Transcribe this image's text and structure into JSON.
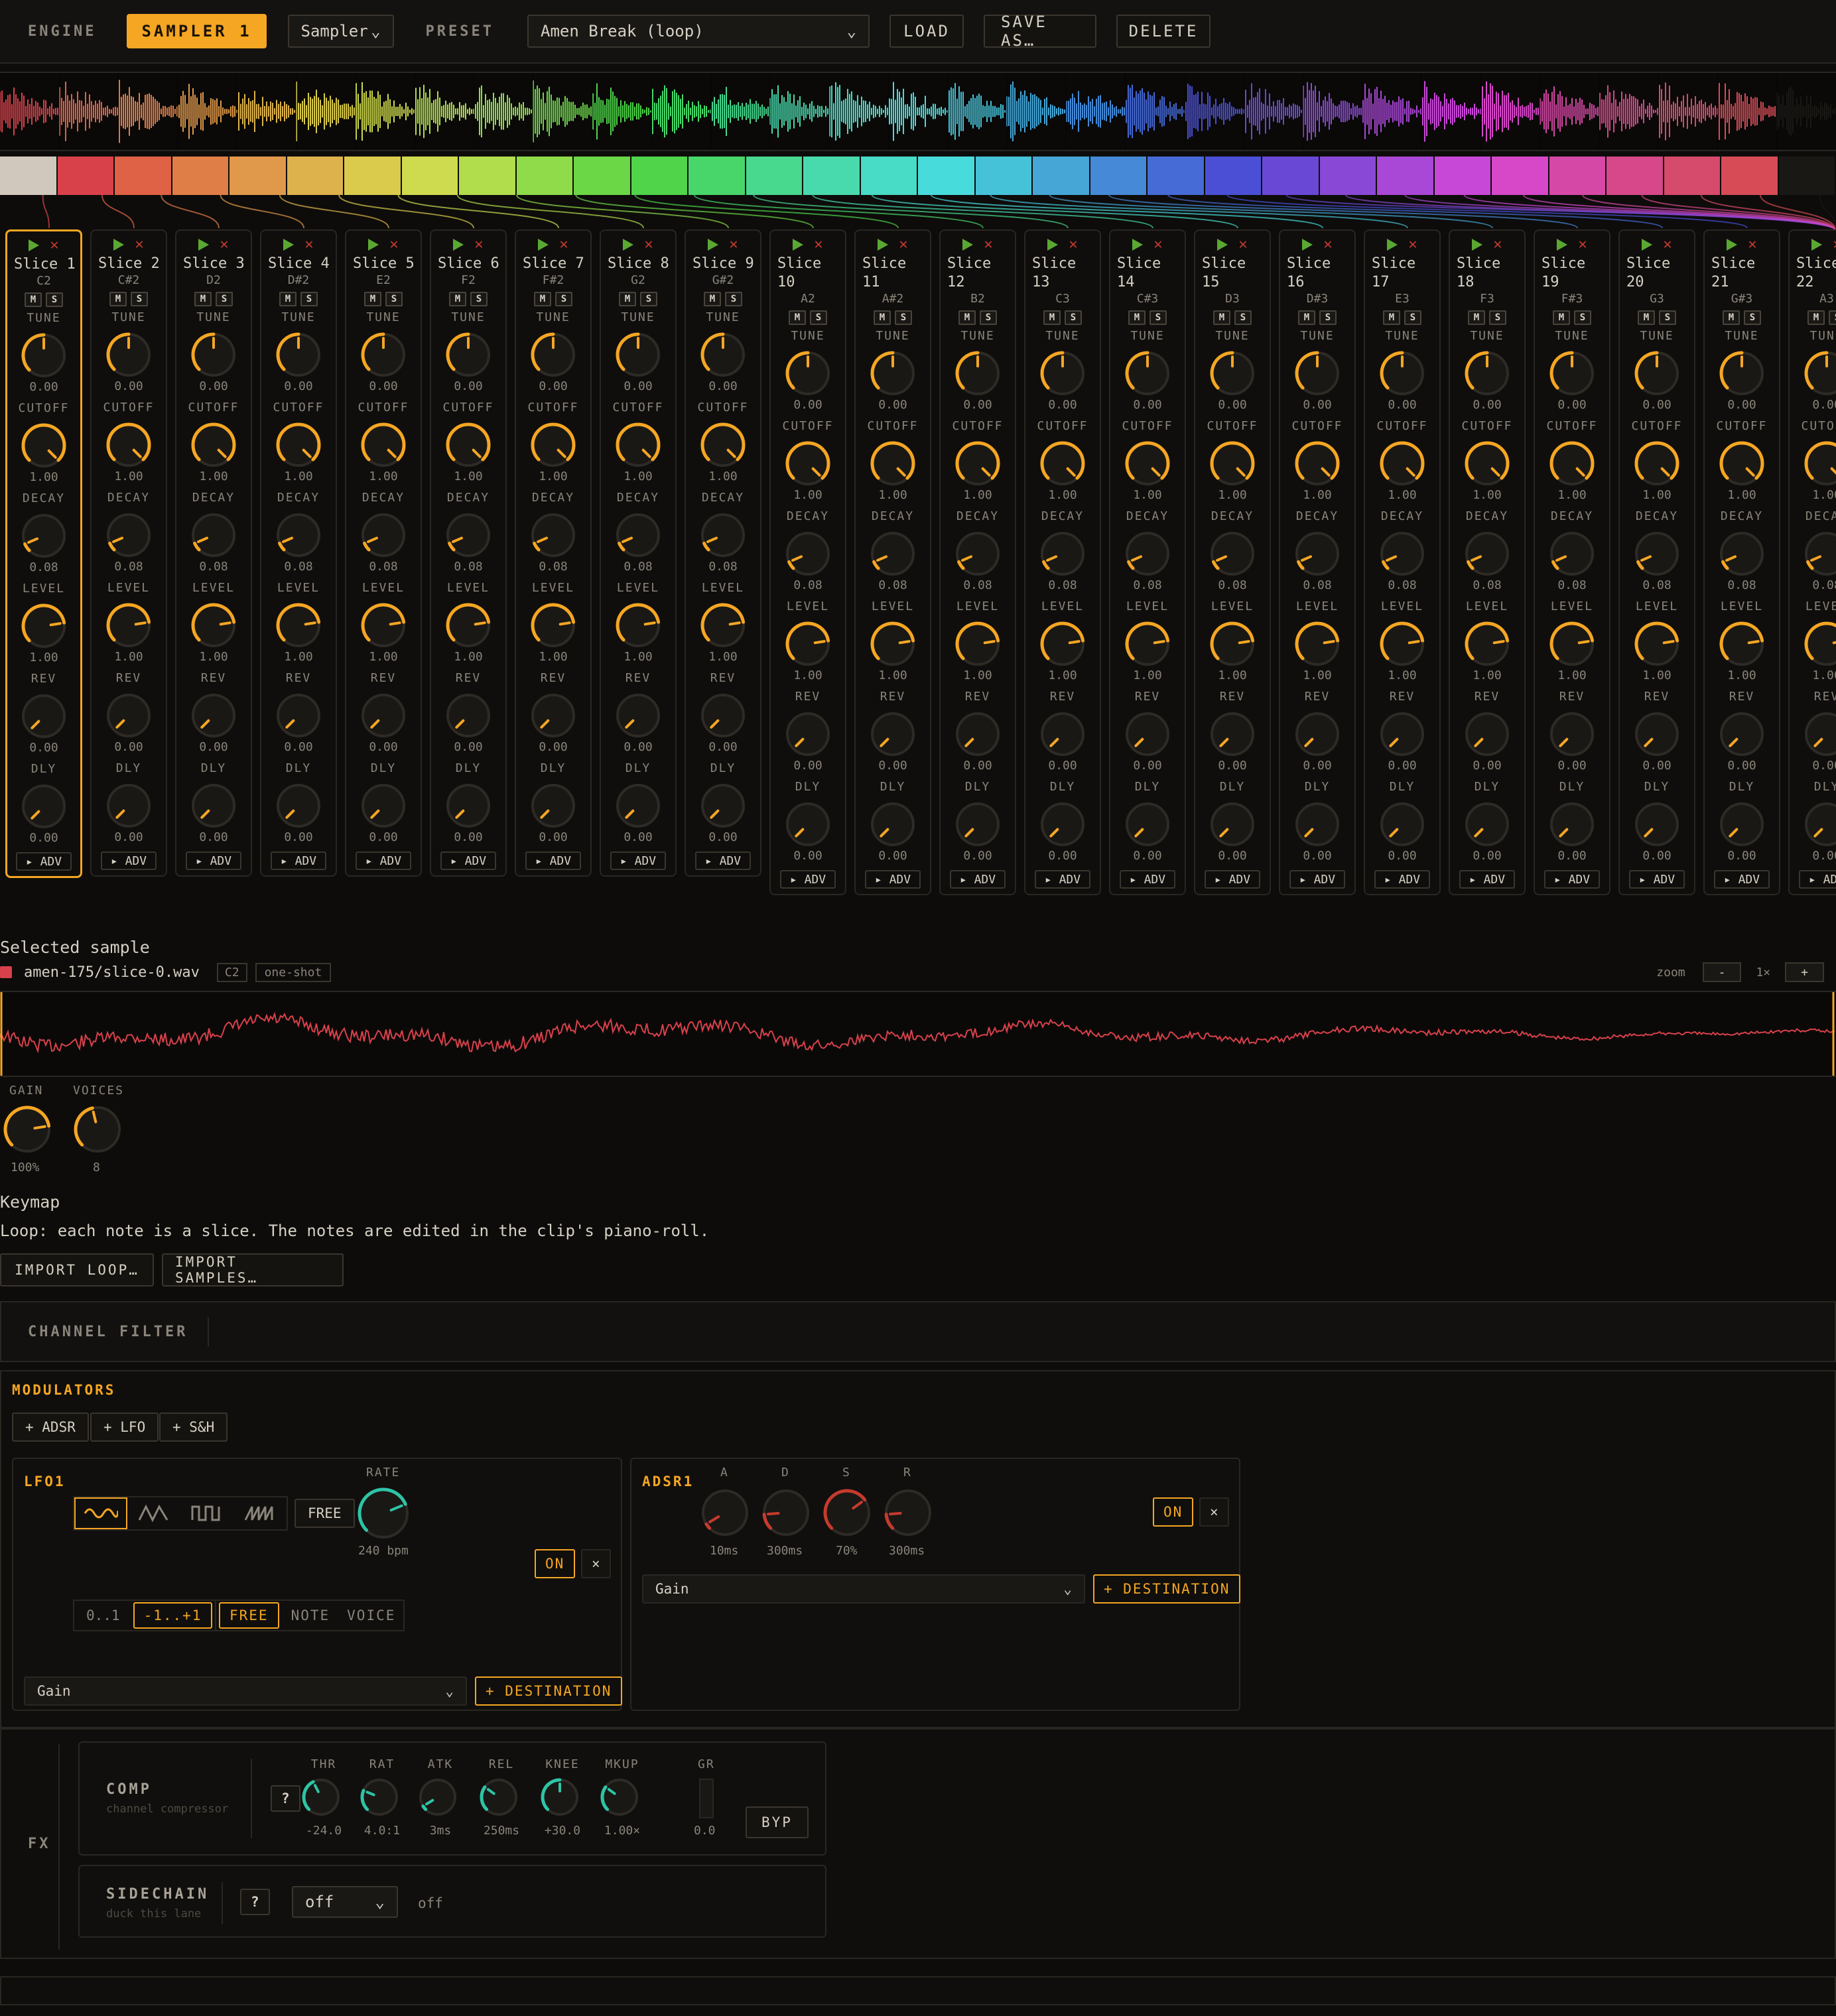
{
  "header": {
    "engine_label": "ENGINE",
    "engine_value": "SAMPLER 1",
    "engine_type": "Sampler",
    "preset_label": "PRESET",
    "preset_value": "Amen Break (loop)",
    "load": "LOAD",
    "save_as": "SAVE AS…",
    "delete": "DELETE"
  },
  "colors": {
    "accent": "#f5a623",
    "teal": "#2ec4a6",
    "red": "#c63a2e",
    "slice_colors": [
      "#d0c8bc",
      "#d9414a",
      "#df6146",
      "#e07e48",
      "#e0994a",
      "#ddb24c",
      "#dacb4c",
      "#cfdb4e",
      "#b1dc4c",
      "#8fdb4a",
      "#6cd746",
      "#4fd44a",
      "#48d66a",
      "#48d88e",
      "#48daad",
      "#48dbc6",
      "#48dbdb",
      "#46c2d8",
      "#46a6d6",
      "#4689d6",
      "#466ad6",
      "#4a4fd6",
      "#6a48d6",
      "#8a48d6",
      "#a948d6",
      "#c748d6",
      "#d648c8",
      "#d648a6",
      "#d6488a",
      "#d64a6c",
      "#d64b56",
      "#1a1815"
    ]
  },
  "slices": [
    {
      "name": "Slice 1",
      "note": "C2"
    },
    {
      "name": "Slice 2",
      "note": "C#2"
    },
    {
      "name": "Slice 3",
      "note": "D2"
    },
    {
      "name": "Slice 4",
      "note": "D#2"
    },
    {
      "name": "Slice 5",
      "note": "E2"
    },
    {
      "name": "Slice 6",
      "note": "F2"
    },
    {
      "name": "Slice 7",
      "note": "F#2"
    },
    {
      "name": "Slice 8",
      "note": "G2"
    },
    {
      "name": "Slice 9",
      "note": "G#2"
    },
    {
      "name": "Slice\n10",
      "note": "A2"
    },
    {
      "name": "Slice\n11",
      "note": "A#2"
    },
    {
      "name": "Slice\n12",
      "note": "B2"
    },
    {
      "name": "Slice\n13",
      "note": "C3"
    },
    {
      "name": "Slice\n14",
      "note": "C#3"
    },
    {
      "name": "Slice\n15",
      "note": "D3"
    },
    {
      "name": "Slice\n16",
      "note": "D#3"
    },
    {
      "name": "Slice\n17",
      "note": "E3"
    },
    {
      "name": "Slice\n18",
      "note": "F3"
    },
    {
      "name": "Slice\n19",
      "note": "F#3"
    },
    {
      "name": "Slice\n20",
      "note": "G3"
    },
    {
      "name": "Slice\n21",
      "note": "G#3"
    },
    {
      "name": "Slice\n22",
      "note": "A3"
    }
  ],
  "strip_labels": {
    "m": "M",
    "s": "S",
    "adv": "▸ ADV"
  },
  "strip_params": [
    {
      "label": "TUNE",
      "value": "0.00",
      "level": 0.5
    },
    {
      "label": "CUTOFF",
      "value": "1.00",
      "level": 1.0
    },
    {
      "label": "DECAY",
      "value": "0.08",
      "level": 0.08
    },
    {
      "label": "LEVEL",
      "value": "1.00",
      "level": 0.8
    },
    {
      "label": "REV",
      "value": "0.00",
      "level": 0.0
    },
    {
      "label": "DLY",
      "value": "0.00",
      "level": 0.0
    }
  ],
  "selected": {
    "title": "Selected sample",
    "file": "amen-175/slice-0.wav",
    "note": "C2",
    "mode": "one-shot",
    "zoom_label": "zoom",
    "zoom_minus": "-",
    "zoom_value": "1×",
    "zoom_plus": "+",
    "gain_label": "GAIN",
    "gain_value": "100%",
    "gain_level": 0.8,
    "voices_label": "VOICES",
    "voices_value": "8",
    "voices_level": 0.45
  },
  "keymap": {
    "title": "Keymap",
    "text": "Loop: each note is a slice. The notes are edited in the clip's piano-roll.",
    "import_loop": "IMPORT LOOP…",
    "import_samples": "IMPORT SAMPLES…"
  },
  "channel_filter": {
    "label": "CHANNEL FILTER"
  },
  "modulators": {
    "title": "MODULATORS",
    "add_adsr": "+ ADSR",
    "add_lfo": "+ LFO",
    "add_sh": "+ S&H",
    "lfo": {
      "title": "LFO1",
      "free": "FREE",
      "rate_label": "RATE",
      "rate_value": "240 bpm",
      "rate_level": 0.75,
      "on": "ON",
      "close": "×",
      "range_a": "0..1",
      "range_b": "-1..+1",
      "mode_free": "FREE",
      "mode_note": "NOTE",
      "mode_voice": "VOICE",
      "dest_value": "Gain",
      "dest_btn": "+ DESTINATION"
    },
    "adsr": {
      "title": "ADSR1",
      "a_label": "A",
      "a_value": "10ms",
      "a_level": 0.05,
      "d_label": "D",
      "d_value": "300ms",
      "d_level": 0.15,
      "s_label": "S",
      "s_value": "70%",
      "s_level": 0.7,
      "r_label": "R",
      "r_value": "300ms",
      "r_level": 0.15,
      "on": "ON",
      "close": "×",
      "dest_value": "Gain",
      "dest_btn": "+ DESTINATION"
    }
  },
  "fx": {
    "label": "FX",
    "comp": {
      "title": "COMP",
      "subtitle": "channel compressor",
      "help": "?",
      "params": [
        {
          "label": "THR",
          "value": "-24.0",
          "level": 0.4
        },
        {
          "label": "RAT",
          "value": "4.0:1",
          "level": 0.25
        },
        {
          "label": "ATK",
          "value": "3ms",
          "level": 0.05
        },
        {
          "label": "REL",
          "value": "250ms",
          "level": 0.3
        },
        {
          "label": "KNEE",
          "value": "+30.0",
          "level": 0.5
        },
        {
          "label": "MKUP",
          "value": "1.00×",
          "level": 0.3
        }
      ],
      "gr_label": "GR",
      "gr_value": "0.0",
      "byp": "BYP"
    },
    "sidechain": {
      "title": "SIDECHAIN",
      "subtitle": "duck this lane",
      "help": "?",
      "select": "off",
      "status": "off"
    }
  }
}
